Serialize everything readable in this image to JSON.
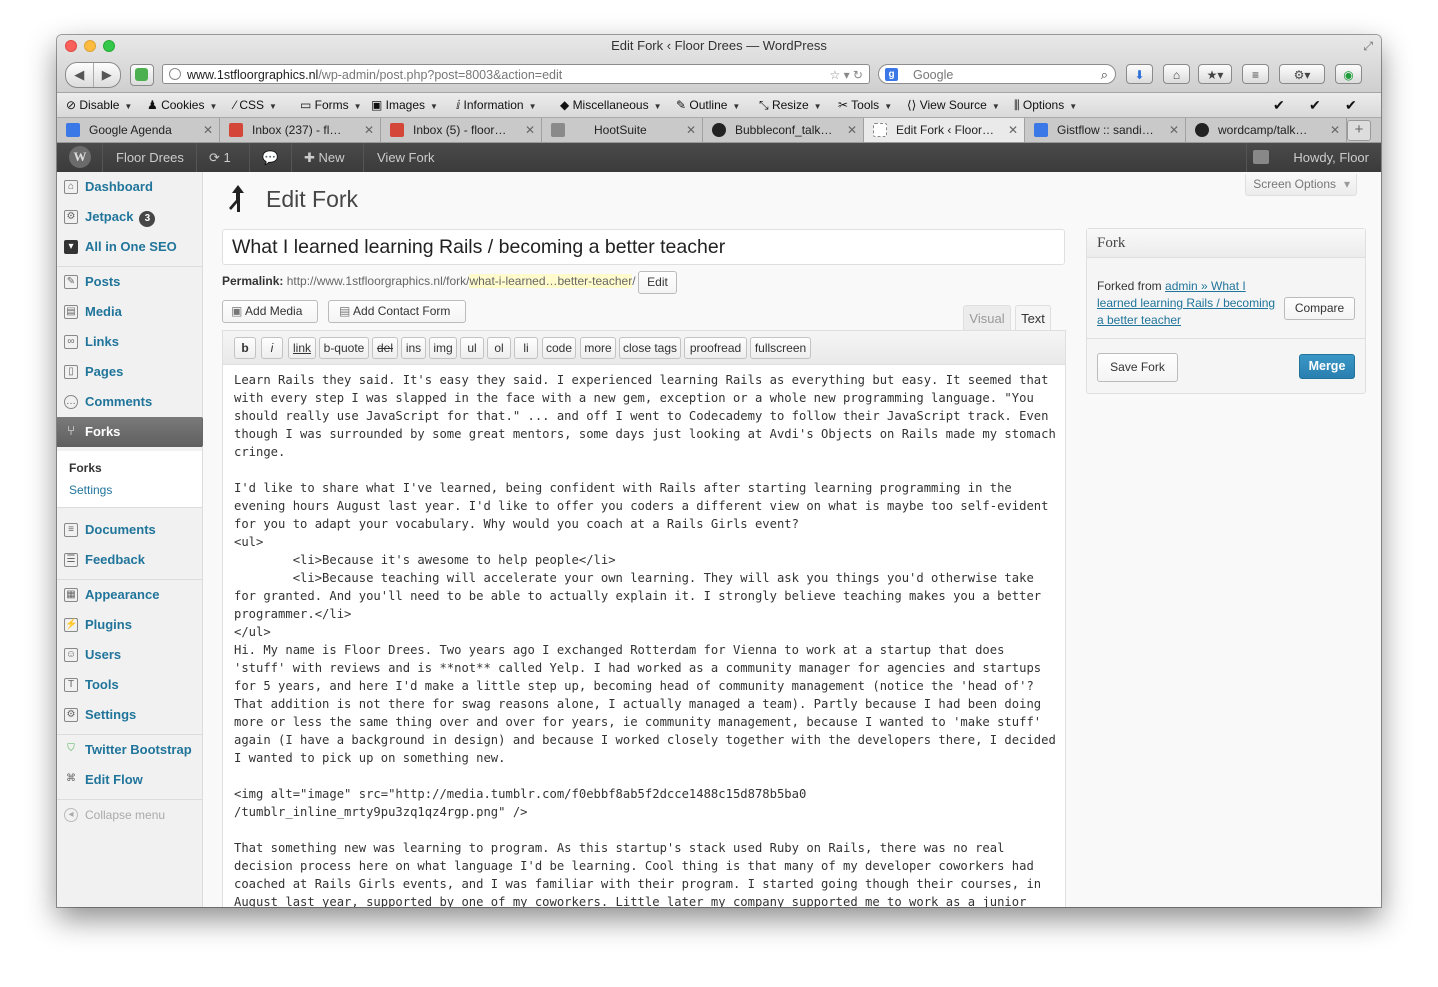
{
  "window": {
    "title": "Edit Fork ‹ Floor Drees — WordPress",
    "url_host": "www.1stfloorgraphics.nl",
    "url_path": "/wp-admin/post.php?post=8003&action=edit",
    "search_placeholder": "Google"
  },
  "devbar": {
    "items": [
      "Disable",
      "Cookies",
      "CSS",
      "Forms",
      "Images",
      "Information",
      "Miscellaneous",
      "Outline",
      "Resize",
      "Tools",
      "View Source",
      "Options"
    ],
    "checks": [
      "✔",
      "✔",
      "✔"
    ]
  },
  "tabs": [
    {
      "title": "Google Agenda",
      "icon_color": "#3b78e7"
    },
    {
      "title": "Inbox (237) - fl…",
      "icon_color": "#d44638"
    },
    {
      "title": "Inbox (5) - floor…",
      "icon_color": "#d44638"
    },
    {
      "title": "HootSuite",
      "icon_color": "#8a8a8a"
    },
    {
      "title": "Bubbleconf_talk…",
      "icon_color": "#222222"
    },
    {
      "title": "Edit Fork ‹ Floor…",
      "icon_color": "#ffffff"
    },
    {
      "title": "Gistflow :: sandi…",
      "icon_color": "#3b78e7"
    },
    {
      "title": "wordcamp/talk…",
      "icon_color": "#222222"
    }
  ],
  "adminbar": {
    "site_name": "Floor Drees",
    "updates_count": "1",
    "new_label": "New",
    "view_label": "View Fork",
    "howdy": "Howdy, Floor"
  },
  "sidebar": {
    "dashboard": "Dashboard",
    "jetpack": "Jetpack",
    "jetpack_badge": "3",
    "seo": "All in One SEO",
    "posts": "Posts",
    "media": "Media",
    "links": "Links",
    "pages": "Pages",
    "comments": "Comments",
    "forks": "Forks",
    "sub_forks": "Forks",
    "sub_settings": "Settings",
    "documents": "Documents",
    "feedback": "Feedback",
    "appearance": "Appearance",
    "plugins": "Plugins",
    "users": "Users",
    "tools": "Tools",
    "settings": "Settings",
    "twitter_bootstrap": "Twitter Bootstrap",
    "edit_flow": "Edit Flow",
    "collapse": "Collapse menu"
  },
  "main": {
    "screen_options": "Screen Options",
    "page_title": "Edit Fork",
    "post_title": "What I learned learning Rails / becoming a better teacher",
    "permalink_label": "Permalink:",
    "permalink_base": "http://www.1stfloorgraphics.nl/fork/",
    "permalink_slug": "what-i-learned…better-teacher",
    "permalink_tail": "/",
    "edit_button": "Edit",
    "add_media": "Add Media",
    "add_contact_form": "Add Contact Form",
    "tab_visual": "Visual",
    "tab_text": "Text",
    "quicktags": [
      "b",
      "i",
      "link",
      "b-quote",
      "del",
      "ins",
      "img",
      "ul",
      "ol",
      "li",
      "code",
      "more",
      "close tags",
      "proofread",
      "fullscreen"
    ],
    "content": "Learn Rails they said. It's easy they said. I experienced learning Rails as everything but easy. It seemed that\nwith every step I was slapped in the face with a new gem, exception or a whole new programming language. \"You\nshould really use JavaScript for that.\" ... and off I went to Codecademy to follow their JavaScript track. Even\nthough I was surrounded by some great mentors, some days just looking at Avdi's Objects on Rails made my stomach\ncringe.\n\nI'd like to share what I've learned, being confident with Rails after starting learning programming in the\nevening hours August last year. I'd like to offer you coders a different view on what is maybe too self-evident\nfor you to adapt your vocabulary. Why would you coach at a Rails Girls event?\n<ul>\n        <li>Because it's awesome to help people</li>\n        <li>Because teaching will accelerate your own learning. They will ask you things you'd otherwise take\nfor granted. And you'll need to be able to actually explain it. I strongly believe teaching makes you a better\nprogrammer.</li>\n</ul>\nHi. My name is Floor Drees. Two years ago I exchanged Rotterdam for Vienna to work at a startup that does\n'stuff' with reviews and is **not** called Yelp. I had worked as a community manager for agencies and startups\nfor 5 years, and here I'd make a little step up, becoming head of community management (notice the 'head of'?\nThat addition is not there for swag reasons alone, I actually managed a team). Partly because I had been doing\nmore or less the same thing over and over for years, ie community management, because I wanted to 'make stuff'\nagain (I have a background in design) and because I worked closely together with the developers there, I decided\nI wanted to pick up on something new.\n\n<img alt=\"image\" src=\"http://media.tumblr.com/f0ebbf8ab5f2dcce1488c15d878b5ba0\n/tumblr_inline_mrty9pu3zq1qz4rgp.png\" />\n\nThat something new was learning to program. As this startup's stack used Ruby on Rails, there was no real\ndecision process here on what language I'd be learning. Cool thing is that many of my developer coworkers had\ncoached at Rails Girls events, and I was familiar with their program. I started going though their courses, in\nAugust last year, supported by one of my coworkers. Little later my company supported me to work as a junior"
  },
  "fork_box": {
    "heading": "Fork",
    "forked_from_label": "Forked from",
    "forked_from_link": "admin » What I learned learning Rails / becoming a better teacher",
    "compare": "Compare",
    "save_fork": "Save Fork",
    "merge": "Merge"
  },
  "colors": {
    "link_blue": "#21759b",
    "admin_bar": "#464646",
    "merge_button": "#2a7fb0"
  }
}
